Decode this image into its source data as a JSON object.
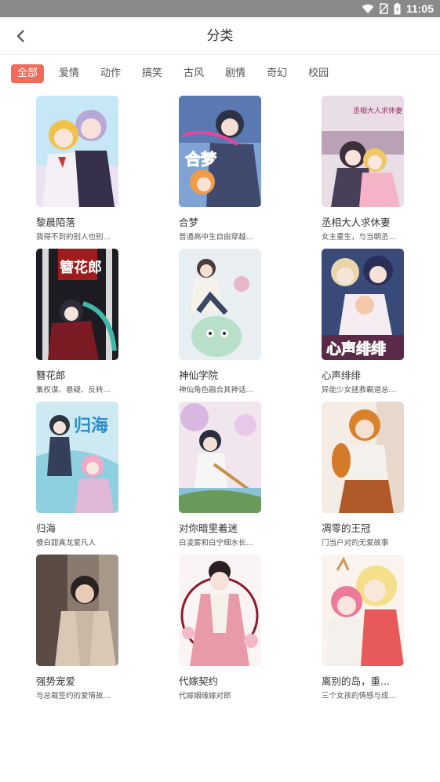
{
  "status": {
    "time": "11:05"
  },
  "header": {
    "title": "分类"
  },
  "tabs": [
    {
      "label": "全部",
      "active": true
    },
    {
      "label": "爱情",
      "active": false
    },
    {
      "label": "动作",
      "active": false
    },
    {
      "label": "搞笑",
      "active": false
    },
    {
      "label": "古风",
      "active": false
    },
    {
      "label": "剧情",
      "active": false
    },
    {
      "label": "奇幻",
      "active": false
    },
    {
      "label": "校园",
      "active": false
    }
  ],
  "comics": [
    {
      "title": "黎晨陌落",
      "desc": "我得不到的别人也别..."
    },
    {
      "title": "合梦",
      "desc": "普通高中生自由穿越..."
    },
    {
      "title": "丞相大人求休妻",
      "desc": "女主重生，与当朝丞..."
    },
    {
      "title": "簪花郎",
      "desc": "集权谋、悬疑、反转..."
    },
    {
      "title": "神仙学院",
      "desc": "神仙角色融合其神话..."
    },
    {
      "title": "心声绯绯",
      "desc": "异能少女拯救霸道总..."
    },
    {
      "title": "归海",
      "desc": "傻白甜真龙爱凡人"
    },
    {
      "title": "对你暗里着迷",
      "desc": "白凌雾和白宁细水长..."
    },
    {
      "title": "凋零的王冠",
      "desc": "门当户对的无爱故事"
    },
    {
      "title": "强势宠爱",
      "desc": "与总裁签约的爱情故..."
    },
    {
      "title": "代嫁契约",
      "desc": "代嫁姻缘嫁对郎"
    },
    {
      "title": "离别的岛，重...",
      "desc": "三个女孩的情感与成..."
    }
  ],
  "cover_text": {
    "c1": "合梦",
    "c3": "丞相大人求休妻",
    "c4": "簪花郎",
    "c6": "心声绯绯",
    "c7": "归海"
  },
  "colors": {
    "accent": "#f26b5b",
    "status_bar": "#8a8a8a"
  }
}
